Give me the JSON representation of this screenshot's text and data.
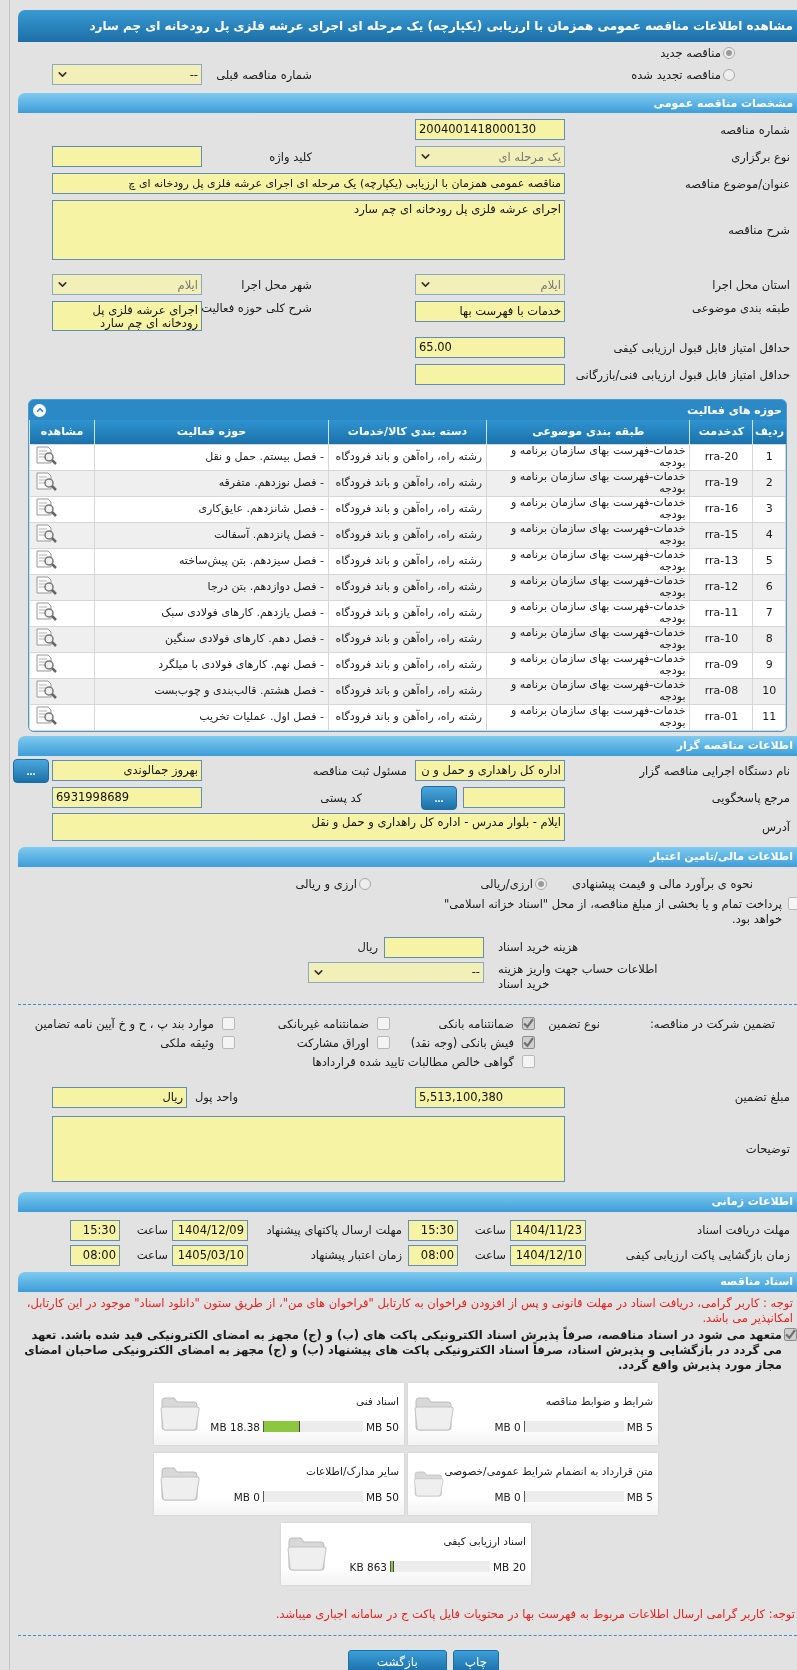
{
  "page_title": "مشاهده اطلاعات مناقصه عمومی همزمان با ارزیابی (یکپارچه) یک مرحله ای اجرای عرشه فلزی پل رودخانه ای چم سارد",
  "tender_kind": [
    {
      "label": "مناقصه جدید",
      "selected": true
    },
    {
      "label": "مناقصه تجدید شده",
      "selected": false
    }
  ],
  "previous_tender": {
    "label": "شماره مناقصه قبلی",
    "value": "--"
  },
  "general": {
    "heading": "مشخصات مناقصه عمومی",
    "tender_number": {
      "label": "شماره مناقصه",
      "value": "2004001418000130"
    },
    "holding_type": {
      "label": "نوع برگزاری",
      "value": "یک مرحله ای"
    },
    "keyword": {
      "label": "کلید واژه"
    },
    "subject": {
      "label": "عنوان/موضوع مناقصه",
      "value": "مناقصه عمومی همزمان با ارزیابی (یکپارچه) یک مرحله ای اجرای عرشه فلزی پل رودخانه ای چ"
    },
    "description": {
      "label": "شرح مناقصه",
      "value": "اجرای عرشه فلزی پل رودخانه ای چم سارد"
    },
    "province": {
      "label": "استان محل اجرا",
      "value": "ایلام"
    },
    "city": {
      "label": "شهر محل اجرا",
      "value": "ایلام"
    },
    "category": {
      "label": "طبقه بندی موضوعی",
      "value": "خدمات با فهرست بها"
    },
    "scope": {
      "label": "شرح کلی حوزه فعالیت",
      "value": "اجرای عرشه فلزی پل رودخانه ای چم سارد"
    },
    "min_quality_score": {
      "label": "حداقل امتیاز قابل قبول ارزیابی کیفی",
      "value": "65.00"
    },
    "min_technical_score": {
      "label": "حداقل امتیاز قابل قبول ارزیابی فنی/بازرگانی"
    }
  },
  "activities": {
    "heading": "حوزه های فعالیت",
    "expanded": true,
    "columns": [
      "ردیف",
      "کدخدمت",
      "طبقه بندی موضوعی",
      "دسته بندی کالا/خدمات",
      "حوزه فعالیت",
      "مشاهده"
    ],
    "rows": [
      {
        "row": "1",
        "code": "rra-20",
        "category": "خدمات-فهرست بهای سازمان برنامه و بودجه",
        "group": "رشته راه، راه‌آهن و باند فرودگاه",
        "activity": "- فصل بیستم. حمل و نقل"
      },
      {
        "row": "2",
        "code": "rra-19",
        "category": "خدمات-فهرست بهای سازمان برنامه و بودجه",
        "group": "رشته راه، راه‌آهن و باند فرودگاه",
        "activity": "- فصل نوزدهم. متفرقه"
      },
      {
        "row": "3",
        "code": "rra-16",
        "category": "خدمات-فهرست بهای سازمان برنامه و بودجه",
        "group": "رشته راه، راه‌آهن و باند فرودگاه",
        "activity": "- فصل شانزدهم. عایق‌کاری"
      },
      {
        "row": "4",
        "code": "rra-15",
        "category": "خدمات-فهرست بهای سازمان برنامه و بودجه",
        "group": "رشته راه، راه‌آهن و باند فرودگاه",
        "activity": "- فصل پانزدهم. آسفالت"
      },
      {
        "row": "5",
        "code": "rra-13",
        "category": "خدمات-فهرست بهای سازمان برنامه و بودجه",
        "group": "رشته راه، راه‌آهن و باند فرودگاه",
        "activity": "- فصل سیزدهم. بتن پیش‌ساخته"
      },
      {
        "row": "6",
        "code": "rra-12",
        "category": "خدمات-فهرست بهای سازمان برنامه و بودجه",
        "group": "رشته راه، راه‌آهن و باند فرودگاه",
        "activity": "- فصل دوازدهم. بتن درجا"
      },
      {
        "row": "7",
        "code": "rra-11",
        "category": "خدمات-فهرست بهای سازمان برنامه و بودجه",
        "group": "رشته راه، راه‌آهن و باند فرودگاه",
        "activity": "- فصل یازدهم. کارهای فولادی سبک"
      },
      {
        "row": "8",
        "code": "rra-10",
        "category": "خدمات-فهرست بهای سازمان برنامه و بودجه",
        "group": "رشته راه، راه‌آهن و باند فرودگاه",
        "activity": "- فصل دهم. کارهای فولادی سنگین"
      },
      {
        "row": "9",
        "code": "rra-09",
        "category": "خدمات-فهرست بهای سازمان برنامه و بودجه",
        "group": "رشته راه، راه‌آهن و باند فرودگاه",
        "activity": "- فصل نهم. کارهای فولادی با میلگرد"
      },
      {
        "row": "10",
        "code": "rra-08",
        "category": "خدمات-فهرست بهای سازمان برنامه و بودجه",
        "group": "رشته راه، راه‌آهن و باند فرودگاه",
        "activity": "- فصل هشتم. قالب‌بندی و چوب‌بست"
      },
      {
        "row": "11",
        "code": "rra-01",
        "category": "خدمات-فهرست بهای سازمان برنامه و بودجه",
        "group": "رشته راه، راه‌آهن و باند فرودگاه",
        "activity": "- فصل اول. عملیات تخریب"
      }
    ]
  },
  "organizer": {
    "heading": "اطلاعات مناقصه گزار",
    "org_name": {
      "label": "نام دستگاه اجرایی مناقصه گزار",
      "value": "اداره کل راهداری و حمل و ن"
    },
    "registrar": {
      "label": "مسئول ثبت مناقصه",
      "value": "بهروز جمالوندی",
      "button": "..."
    },
    "reference": {
      "label": "مرجع پاسخگویی",
      "button": "..."
    },
    "postal_code": {
      "label": "کد پستی",
      "value": "6931998689"
    },
    "address": {
      "label": "آدرس",
      "value": "ایلام - بلوار مدرس - اداره کل راهداری و حمل و نقل"
    }
  },
  "finance": {
    "heading": "اطلاعات مالی/تامین اعتبار",
    "estimate": {
      "label": "نحوه ی برآورد مالی و قیمت پیشنهادی",
      "options": [
        {
          "label": "ارزی/ریالی",
          "selected": true
        },
        {
          "label": "ارزی و ریالی",
          "selected": false
        }
      ]
    },
    "treasury": {
      "label": "پرداخت تمام و یا بخشی از مبلغ مناقصه، از محل \"اسناد خزانه اسلامی\" خواهد بود.",
      "checked": false
    },
    "doc_cost": {
      "label": "هزینه خرید اسناد",
      "unit": "ریال"
    },
    "account": {
      "label": "اطلاعات حساب جهت واریز هزینه خرید اسناد",
      "value": "--"
    },
    "guarantee": {
      "label": "تضمین شرکت در مناقصه:",
      "type_label": "نوع تضمین",
      "options": [
        {
          "label": "ضمانتنامه بانکی",
          "checked": true
        },
        {
          "label": "ضمانتنامه غیربانکی",
          "checked": false
        },
        {
          "label": "موارد بند پ ، ح و خ آیین نامه تضامین",
          "checked": false
        },
        {
          "label": "فیش بانکی (وجه نقد)",
          "checked": true
        },
        {
          "label": "اوراق مشارکت",
          "checked": false
        },
        {
          "label": "وثیقه ملکی",
          "checked": false
        },
        {
          "label": "گواهی خالص مطالبات تایید شده قراردادها",
          "checked": false
        }
      ]
    },
    "amount": {
      "label": "مبلغ تضمین",
      "value": "5,513,100,380"
    },
    "currency": {
      "label": "واحد پول",
      "value": "ریال"
    },
    "notes": {
      "label": "توضیحات"
    }
  },
  "schedule": {
    "heading": "اطلاعات زمانی",
    "items": [
      {
        "label": "مهلت دریافت اسناد",
        "date": "1404/11/23",
        "time_label": "ساعت",
        "time": "15:30"
      },
      {
        "label": "مهلت ارسال پاکتهای پیشنهاد",
        "date": "1404/12/09",
        "time_label": "ساعت",
        "time": "15:30"
      },
      {
        "label": "زمان بازگشایی پاکت ارزیابی کیفی",
        "date": "1404/12/10",
        "time_label": "ساعت",
        "time": "08:00"
      },
      {
        "label": "زمان اعتبار پیشنهاد",
        "date": "1405/03/10",
        "time_label": "ساعت",
        "time": "08:00"
      }
    ]
  },
  "documents": {
    "heading": "اسناد مناقصه",
    "notice": "توجه : کاربر گرامی، دریافت اسناد در مهلت قانونی و پس از افزودن فراخوان به کارتابل \"فراخوان های من\"، از طریق ستون \"دانلود اسناد\" موجود در این کارتابل، امکانپذیر می باشد.",
    "commitment": {
      "text": "متعهد می شود در اسناد مناقصه، صرفاً پذیرش اسناد الکترونیکی پاکت های (ب) و (ج) مجهز به امضای الکترونیکی قید شده باشد. تعهد می گردد در بازگشایی و پذیرش اسناد، صرفاً اسناد الکترونیکی پاکت های پیشنهاد (ب) و (ج) مجهز به امضای الکترونیکی صاحبان امضای مجاز مورد پذیرش واقع گردد.",
      "checked": true
    },
    "files": [
      {
        "name": "شرایط و ضوابط مناقصه",
        "used": "0 MB",
        "max": "5 MB",
        "level": 0
      },
      {
        "name": "اسناد فنی",
        "used": "18.38 MB",
        "max": "50 MB",
        "level": 0.37
      },
      {
        "name": "متن قرارداد به انضمام شرایط عمومی/خصوصی",
        "used": "0 MB",
        "max": "5 MB",
        "level": 0
      },
      {
        "name": "سایر مدارک/اطلاعات",
        "used": "0 MB",
        "max": "50 MB",
        "level": 0
      },
      {
        "name": "اسناد ارزیابی کیفی",
        "used": "863 KB",
        "max": "20 MB",
        "level": 0.04
      }
    ],
    "footer_notice": "توجه: کاربر گرامی ارسال اطلاعات مربوط به فهرست بها در محتویات فایل پاکت ج در سامانه اجباری میباشد."
  },
  "buttons": [
    {
      "label": "چاپ"
    },
    {
      "label": "بازگشت"
    }
  ]
}
